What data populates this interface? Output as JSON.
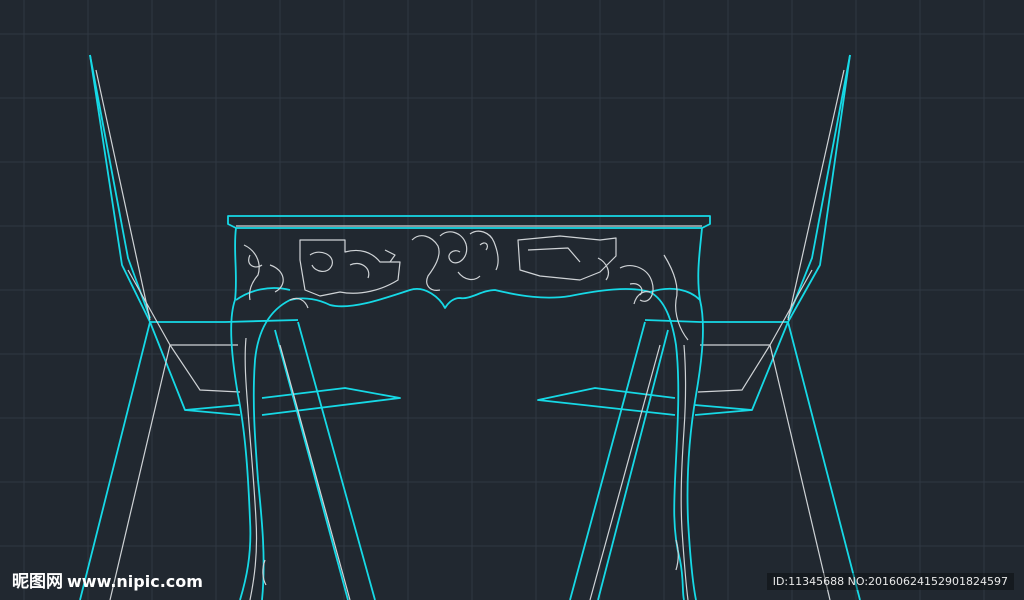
{
  "colors": {
    "background": "#212830",
    "grid": "#2f3842",
    "cyan": "#16d9e6",
    "white": "#cfd3d6"
  },
  "watermark": {
    "brand": "昵图网",
    "site": "www.nipic.com",
    "id_text": "ID:11345688 NO:20160624152901824597"
  }
}
